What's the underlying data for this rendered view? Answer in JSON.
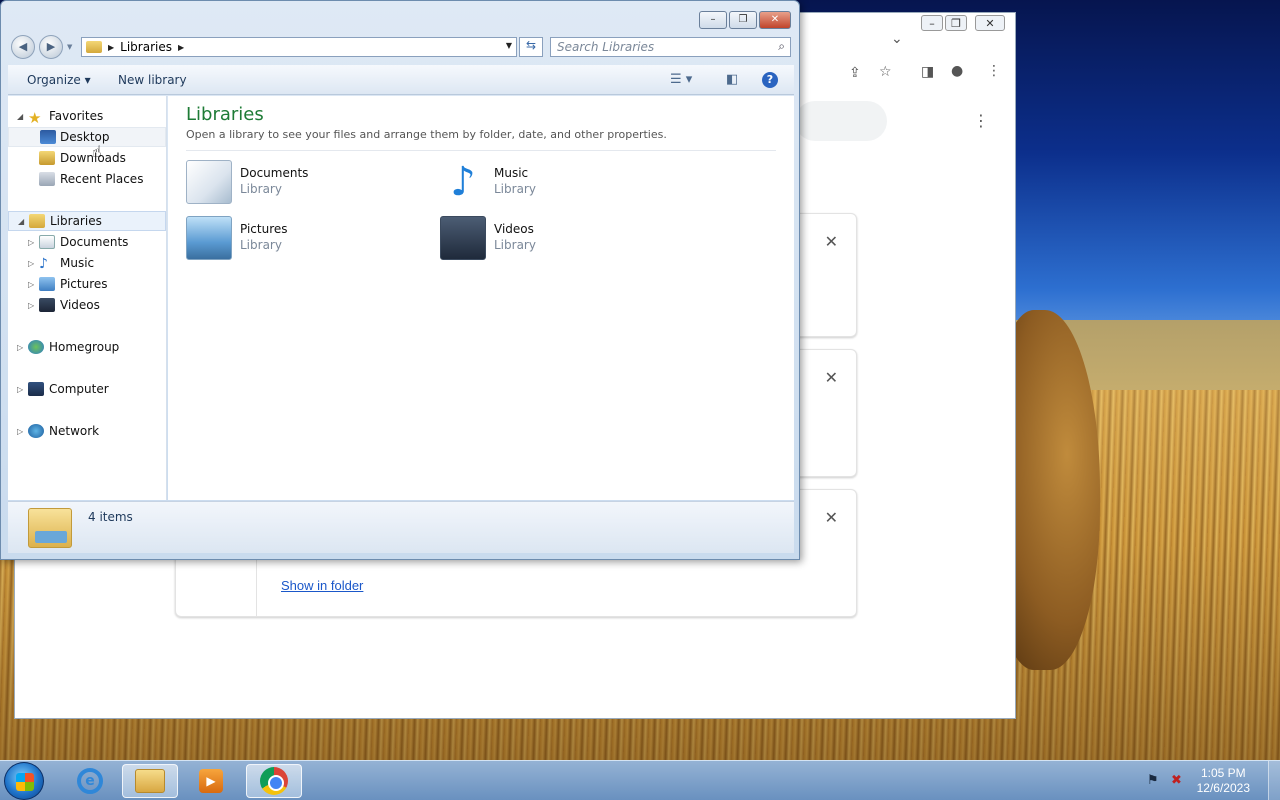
{
  "explorer": {
    "address": {
      "crumb": "Libraries"
    },
    "search": {
      "placeholder": "Search Libraries"
    },
    "commands": {
      "organize": "Organize",
      "new_library": "New library"
    },
    "nav": {
      "favorites": "Favorites",
      "desktop": "Desktop",
      "downloads": "Downloads",
      "recent_places": "Recent Places",
      "libraries": "Libraries",
      "documents": "Documents",
      "music": "Music",
      "pictures": "Pictures",
      "videos": "Videos",
      "homegroup": "Homegroup",
      "computer": "Computer",
      "network": "Network"
    },
    "content": {
      "title": "Libraries",
      "subtitle": "Open a library to see your files and arrange them by folder, date, and other properties.",
      "items": [
        {
          "name": "Documents",
          "kind": "Library"
        },
        {
          "name": "Music",
          "kind": "Library"
        },
        {
          "name": "Pictures",
          "kind": "Library"
        },
        {
          "name": "Videos",
          "kind": "Library"
        }
      ]
    },
    "status": {
      "count": "4 items"
    }
  },
  "chrome": {
    "downloads": {
      "show_in_folder": "Show in folder"
    }
  },
  "taskbar": {
    "clock": {
      "time": "1:05 PM",
      "date": "12/6/2023"
    }
  },
  "colors": {
    "library_title": "#1e7b36",
    "link": "#1a57c9",
    "close_button": "#c0442b"
  }
}
